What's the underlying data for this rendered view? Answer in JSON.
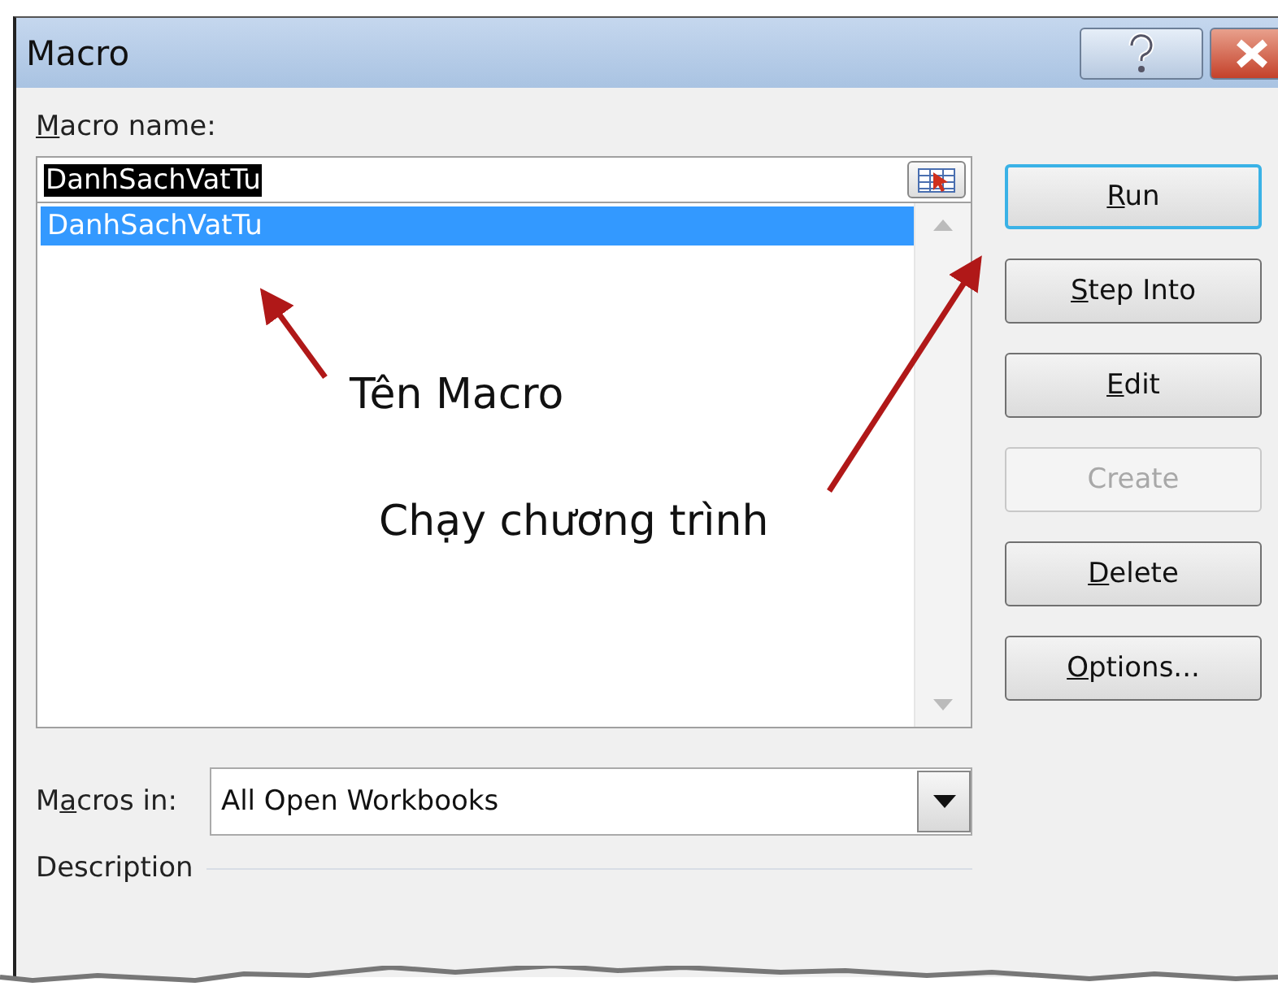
{
  "window": {
    "title": "Macro"
  },
  "macro_name": {
    "label": {
      "mnemonic": "M",
      "after": "acro name:"
    },
    "value": "DanhSachVatTu",
    "text_selected": true
  },
  "macro_list": [
    {
      "name": "DanhSachVatTu",
      "selected": true
    }
  ],
  "buttons": [
    {
      "label": {
        "mnemonic": "R",
        "after": "un"
      },
      "default": true,
      "disabled": false
    },
    {
      "label": {
        "mnemonic": "S",
        "after": "tep Into"
      },
      "default": false,
      "disabled": false
    },
    {
      "label": {
        "mnemonic": "E",
        "after": "dit"
      },
      "default": false,
      "disabled": false
    },
    {
      "label": {
        "before": "Create"
      },
      "default": false,
      "disabled": true
    },
    {
      "label": {
        "mnemonic": "D",
        "after": "elete"
      },
      "default": false,
      "disabled": false
    },
    {
      "label": {
        "mnemonic": "O",
        "after": "ptions..."
      },
      "default": false,
      "disabled": false
    }
  ],
  "macros_in": {
    "label": {
      "before": "M",
      "mnemonic": "a",
      "after": "cros in:"
    },
    "value": "All Open Workbooks"
  },
  "description": {
    "label": "Description"
  },
  "annotations": [
    {
      "text": "Tên Macro",
      "kind": "list"
    },
    {
      "text": "Chạy chương trình",
      "kind": "run"
    }
  ]
}
